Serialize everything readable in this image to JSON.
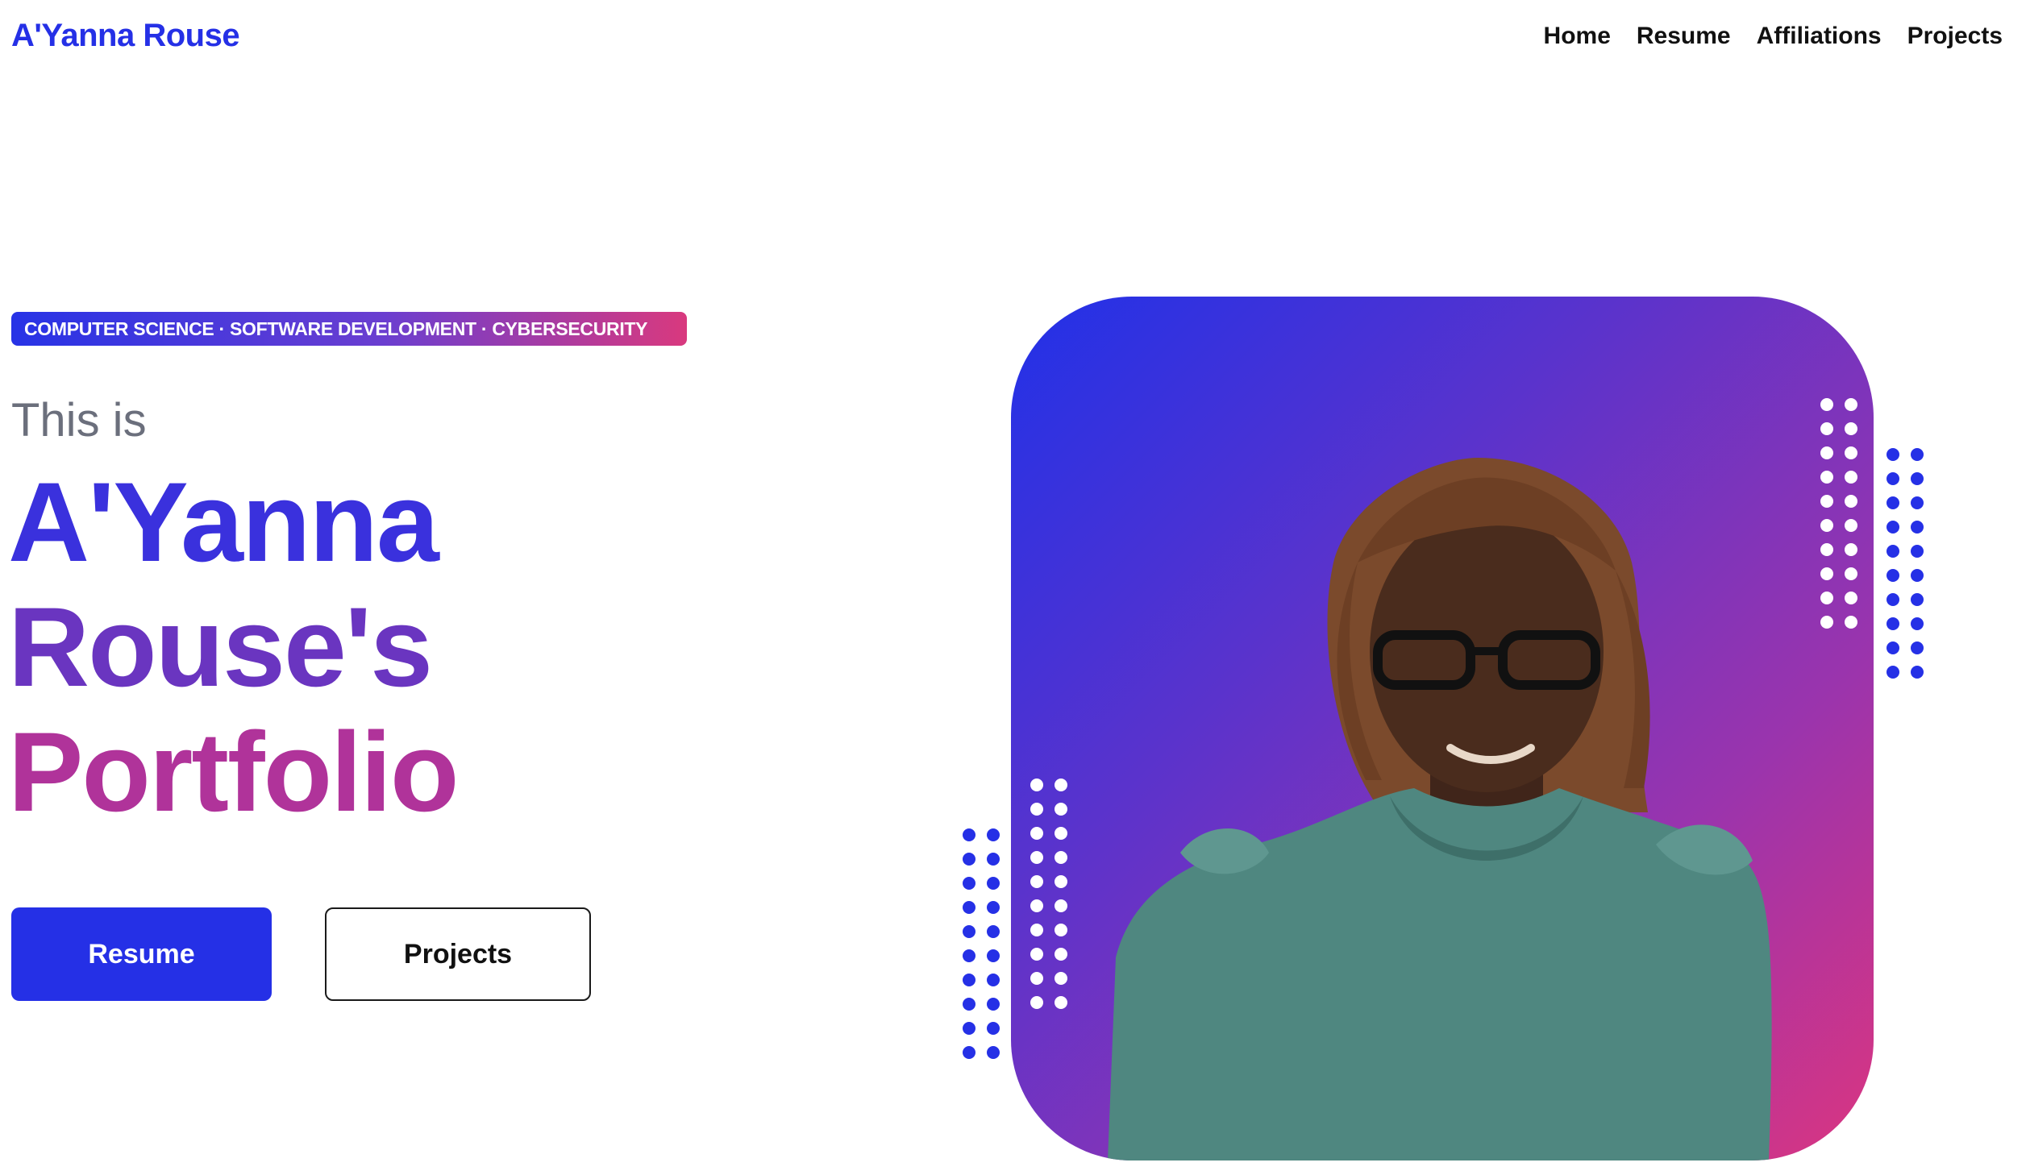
{
  "header": {
    "brand": "A'Yanna Rouse",
    "nav": [
      {
        "label": "Home"
      },
      {
        "label": "Resume"
      },
      {
        "label": "Affiliations"
      },
      {
        "label": "Projects"
      }
    ]
  },
  "hero": {
    "tagline": "COMPUTER SCIENCE · SOFTWARE DEVELOPMENT · CYBERSECURITY",
    "intro": "This is",
    "headline": [
      "A'Yanna",
      "Rouse's",
      "Portfolio"
    ],
    "buttons": {
      "primary": "Resume",
      "secondary": "Projects"
    },
    "portrait_icon": "portrait-photo"
  },
  "colors": {
    "accent_blue": "#2530e6",
    "gradient_start": "#2131e8",
    "gradient_mid": "#6a35c0",
    "gradient_end": "#db3580",
    "shirt": "#4f8780",
    "skin": "#4a2c1d",
    "hair": "#7b4a2c",
    "dots_white": "#ffffff",
    "dots_blue": "#2530e6"
  }
}
